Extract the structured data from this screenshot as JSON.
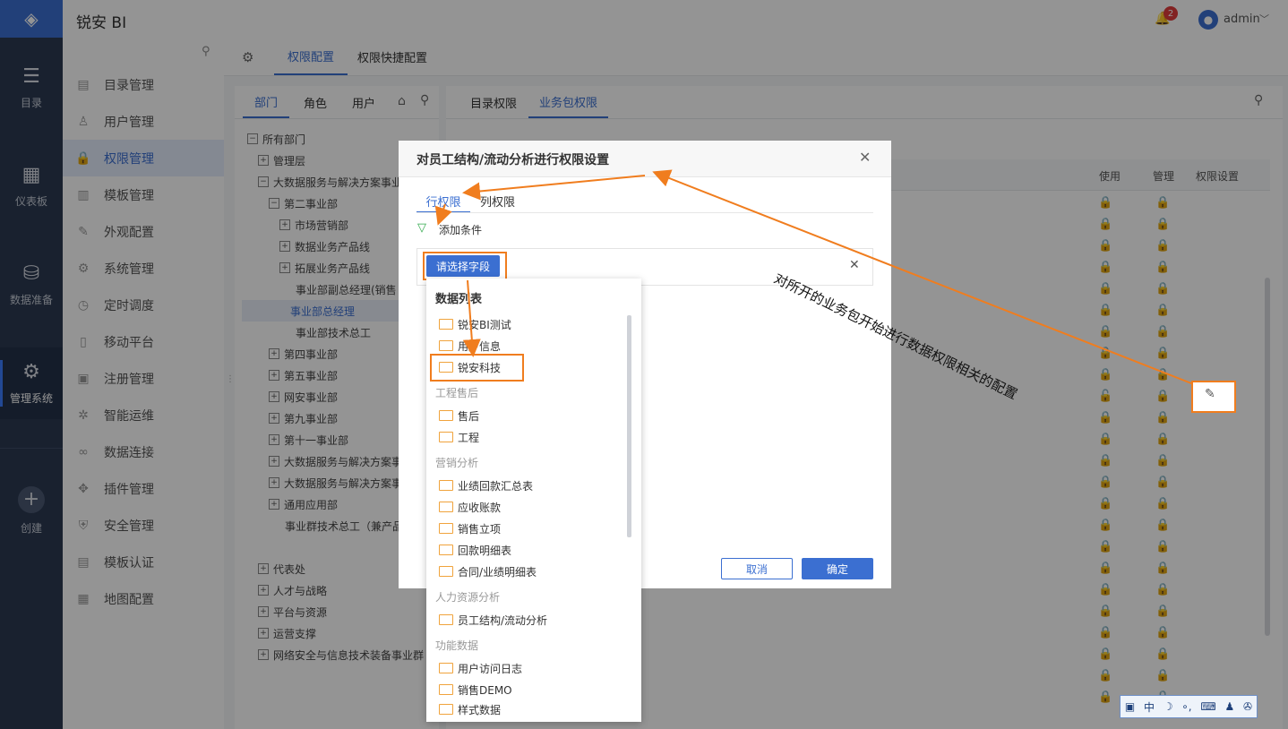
{
  "app": {
    "title": "锐安 BI",
    "notifications": "2",
    "user": "admin"
  },
  "rail": [
    {
      "label": "目录",
      "icon": "list-icon"
    },
    {
      "label": "仪表板",
      "icon": "dashboard-icon"
    },
    {
      "label": "数据准备",
      "icon": "database-icon"
    },
    {
      "label": "管理系统",
      "icon": "gear-icon"
    },
    {
      "label": "创建",
      "icon": "plus-icon"
    }
  ],
  "menu": [
    {
      "label": "目录管理"
    },
    {
      "label": "用户管理"
    },
    {
      "label": "权限管理"
    },
    {
      "label": "模板管理"
    },
    {
      "label": "外观配置"
    },
    {
      "label": "系统管理"
    },
    {
      "label": "定时调度"
    },
    {
      "label": "移动平台"
    },
    {
      "label": "注册管理"
    },
    {
      "label": "智能运维"
    },
    {
      "label": "数据连接"
    },
    {
      "label": "插件管理"
    },
    {
      "label": "安全管理"
    },
    {
      "label": "模板认证"
    },
    {
      "label": "地图配置"
    }
  ],
  "tabs": {
    "perm_config": "权限配置",
    "perm_quick": "权限快捷配置"
  },
  "left_tabs": {
    "dept": "部门",
    "role": "角色",
    "user": "用户"
  },
  "right_tabs": {
    "catalog": "目录权限",
    "business": "业务包权限"
  },
  "columns": {
    "use": "使用",
    "manage": "管理",
    "setting": "权限设置"
  },
  "tree": [
    {
      "label": "所有部门"
    },
    {
      "label": "管理层"
    },
    {
      "label": "大数据服务与解决方案事业"
    },
    {
      "label": "第二事业部"
    },
    {
      "label": "市场营销部"
    },
    {
      "label": "数据业务产品线"
    },
    {
      "label": "拓展业务产品线"
    },
    {
      "label": "事业部副总经理(销售"
    },
    {
      "label": "事业部总经理"
    },
    {
      "label": "事业部技术总工"
    },
    {
      "label": "第四事业部"
    },
    {
      "label": "第五事业部"
    },
    {
      "label": "网安事业部"
    },
    {
      "label": "第九事业部"
    },
    {
      "label": "第十一事业部"
    },
    {
      "label": "大数据服务与解决方案事"
    },
    {
      "label": "大数据服务与解决方案事"
    },
    {
      "label": "通用应用部"
    },
    {
      "label": "事业群技术总工（兼产品"
    },
    {
      "label": "代表处"
    },
    {
      "label": "人才与战略"
    },
    {
      "label": "平台与资源"
    },
    {
      "label": "运营支撑"
    },
    {
      "label": "网络安全与信息技术装备事业群"
    }
  ],
  "dialog": {
    "title": "对员工结构/流动分析进行权限设置",
    "tab_row": "行权限",
    "tab_col": "列权限",
    "add_condition": "添加条件",
    "select_field": "请选择字段",
    "cancel": "取消",
    "ok": "确定"
  },
  "dropdown": {
    "header": "数据列表",
    "groups_top": [
      "锐安BI测试",
      "用户信息",
      "锐安科技"
    ],
    "group1": "工程售后",
    "group1_items": [
      "售后",
      "工程"
    ],
    "group2": "营销分析",
    "group2_items": [
      "业绩回款汇总表",
      "应收账款",
      "销售立项",
      "回款明细表",
      "合同/业绩明细表"
    ],
    "group3": "人力资源分析",
    "group3_items": [
      "员工结构/流动分析"
    ],
    "group4": "功能数据",
    "group4_items": [
      "用户访问日志",
      "销售DEMO",
      "样式数据"
    ]
  },
  "annotation": "对所开的业务包开始进行数据权限相关的配置",
  "ime": {
    "mode": "中"
  },
  "colors": {
    "brand": "#3b6fd1",
    "highlight": "#f07d1e",
    "rail": "#2c3a52"
  }
}
